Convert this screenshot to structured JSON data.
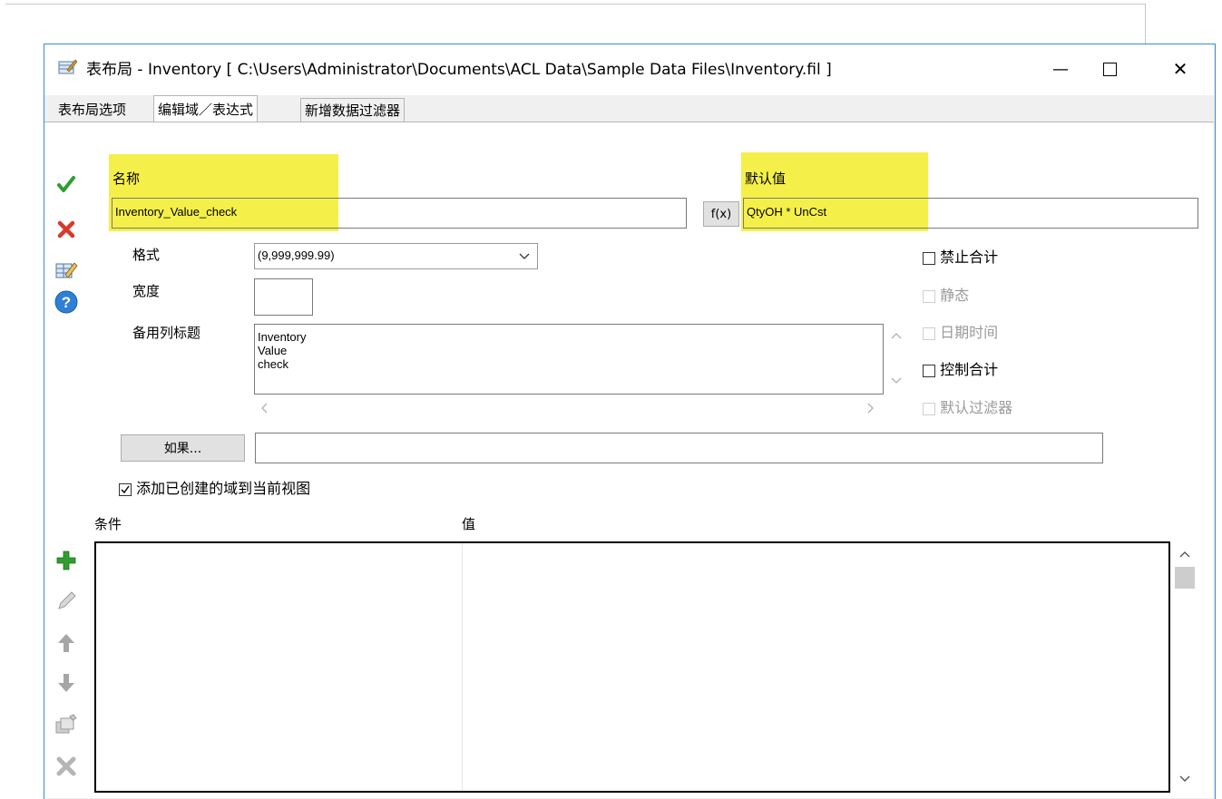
{
  "window": {
    "title": "表布局 - Inventory [ C:\\Users\\Administrator\\Documents\\ACL Data\\Sample Data Files\\Inventory.fil ]",
    "minimize_glyph": "—",
    "maximize_glyph": "☐",
    "close_glyph": "✕"
  },
  "tabs": [
    {
      "label": "表布局选项"
    },
    {
      "label": "编辑域／表达式"
    },
    {
      "label": "新增数据过滤器"
    }
  ],
  "form": {
    "name_label": "名称",
    "name_value": "Inventory_Value_check",
    "default_label": "默认值",
    "fx_button": "f(x)",
    "default_value": "QtyOH * UnCst",
    "format_label": "格式",
    "format_value": "(9,999,999.99)",
    "width_label": "宽度",
    "width_value": "",
    "alt_header_label": "备用列标题",
    "alt_header_lines": [
      "Inventory",
      "Value",
      "check"
    ],
    "if_button": "如果...",
    "if_value": "",
    "add_to_view_label": "添加已创建的域到当前视图",
    "add_to_view_checked": true
  },
  "options": [
    {
      "label": "禁止合计",
      "enabled": true,
      "checked": false
    },
    {
      "label": "静态",
      "enabled": false,
      "checked": false
    },
    {
      "label": "日期时间",
      "enabled": false,
      "checked": false
    },
    {
      "label": "控制合计",
      "enabled": true,
      "checked": false
    },
    {
      "label": "默认过滤器",
      "enabled": false,
      "checked": false
    }
  ],
  "conditions_table": {
    "columns": [
      "条件",
      "值"
    ],
    "rows": []
  },
  "colors": {
    "highlight": "#f5f049",
    "accept": "#2e9e2e",
    "reject": "#d63a2a",
    "help": "#2f7fd6",
    "window_border": "#3c8ad8"
  },
  "icons": {
    "accept": "checkmark-icon",
    "reject": "x-icon",
    "edit_table": "edit-table-icon",
    "help": "help-icon",
    "add": "plus-icon",
    "edit": "pencil-icon",
    "up": "arrow-up-icon",
    "down": "arrow-down-icon",
    "copy": "copy-icon",
    "delete": "delete-icon"
  }
}
